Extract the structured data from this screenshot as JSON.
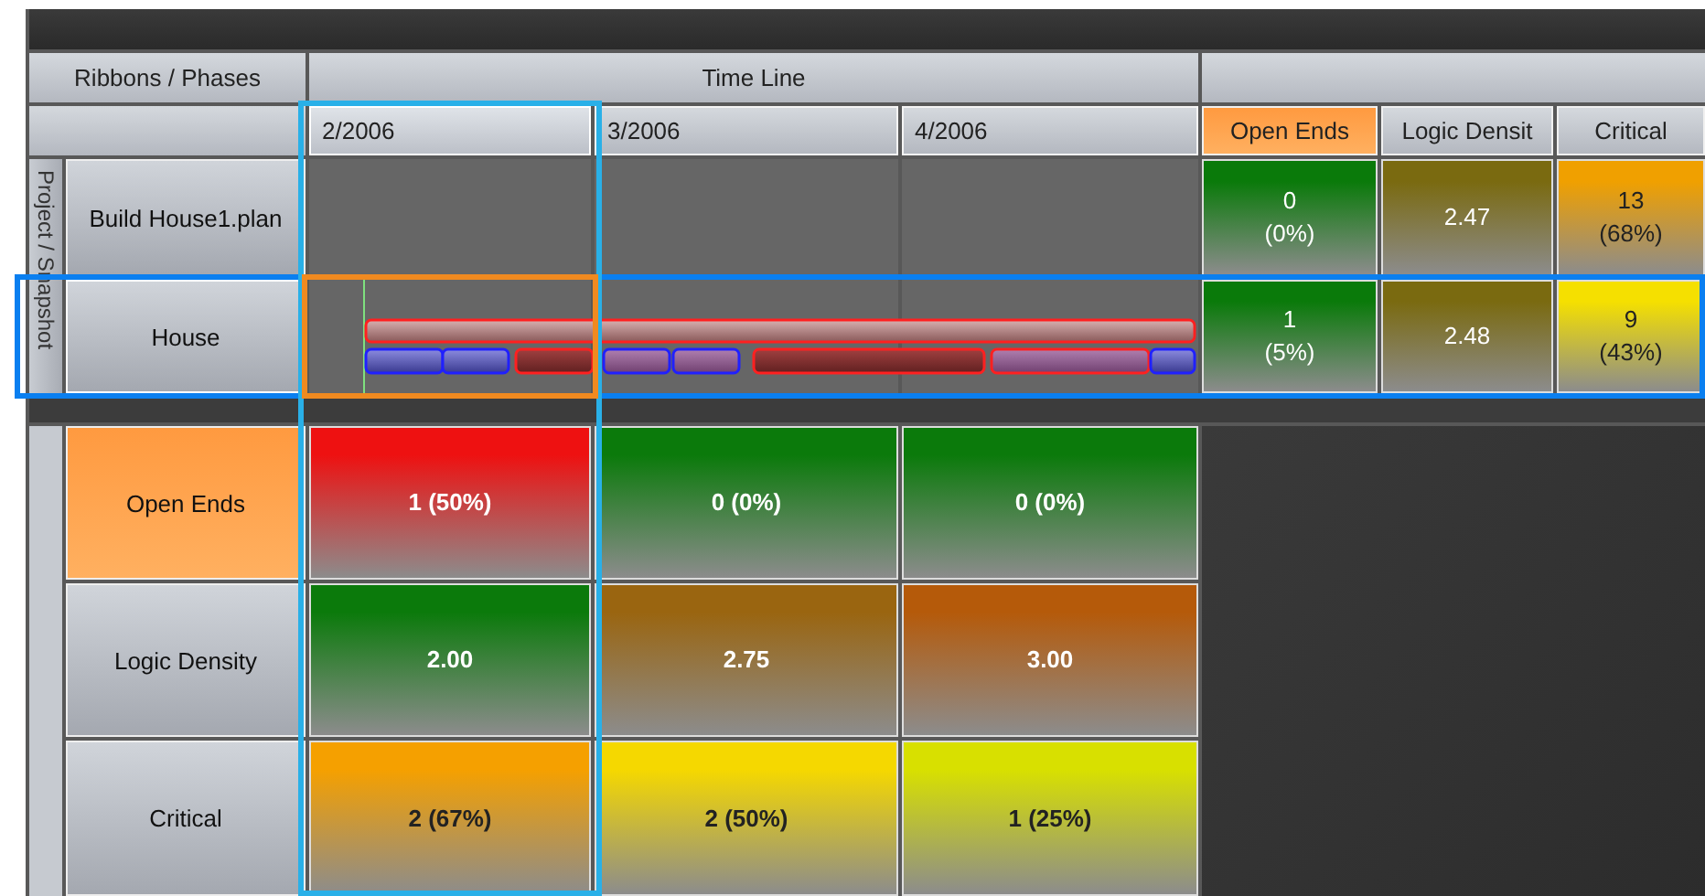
{
  "header": {
    "ribbons": "Ribbons / Phases",
    "timeline": "Time Line"
  },
  "months": [
    {
      "label": "2/2006",
      "selected": true
    },
    {
      "label": "3/2006",
      "selected": false
    },
    {
      "label": "4/2006",
      "selected": false
    }
  ],
  "metrics": [
    {
      "label": "Open Ends",
      "selected": true
    },
    {
      "label": "Logic Densit",
      "selected": false
    },
    {
      "label": "Critical",
      "selected": false
    }
  ],
  "group_label": "Project / Snapshot",
  "projects": [
    {
      "name": "Build House1.plan",
      "selected": false,
      "kind": "plan",
      "cells": [
        {
          "text": "0\n(0%)",
          "color": "#0a7a0a"
        },
        {
          "text": "2.47",
          "color": "#7a6a10"
        },
        {
          "text": "13\n(68%)",
          "color": "#f0a000"
        }
      ]
    },
    {
      "name": "House",
      "selected": true,
      "kind": "snapshot",
      "cells": [
        {
          "text": "1\n(5%)",
          "color": "#0a7a0a"
        },
        {
          "text": "2.48",
          "color": "#7a6a10"
        },
        {
          "text": "9\n(43%)",
          "color": "#f5e000"
        }
      ]
    }
  ],
  "phase_rows": [
    {
      "label": "Open Ends",
      "selected": true,
      "cells": [
        {
          "text": "1 (50%)",
          "color": "#ee1111"
        },
        {
          "text": "0 (0%)",
          "color": "#0b7a0b"
        },
        {
          "text": "0 (0%)",
          "color": "#0b7a0b"
        }
      ]
    },
    {
      "label": "Logic Density",
      "selected": false,
      "cells": [
        {
          "text": "2.00",
          "color": "#0b7a0b"
        },
        {
          "text": "2.75",
          "color": "#9a6510"
        },
        {
          "text": "3.00",
          "color": "#b55a0a"
        }
      ]
    },
    {
      "label": "Critical",
      "selected": false,
      "cells": [
        {
          "text": "2 (67%)",
          "color": "#f5a000"
        },
        {
          "text": "2 (50%)",
          "color": "#f5d800"
        },
        {
          "text": "1 (25%)",
          "color": "#d8e000"
        }
      ]
    }
  ]
}
